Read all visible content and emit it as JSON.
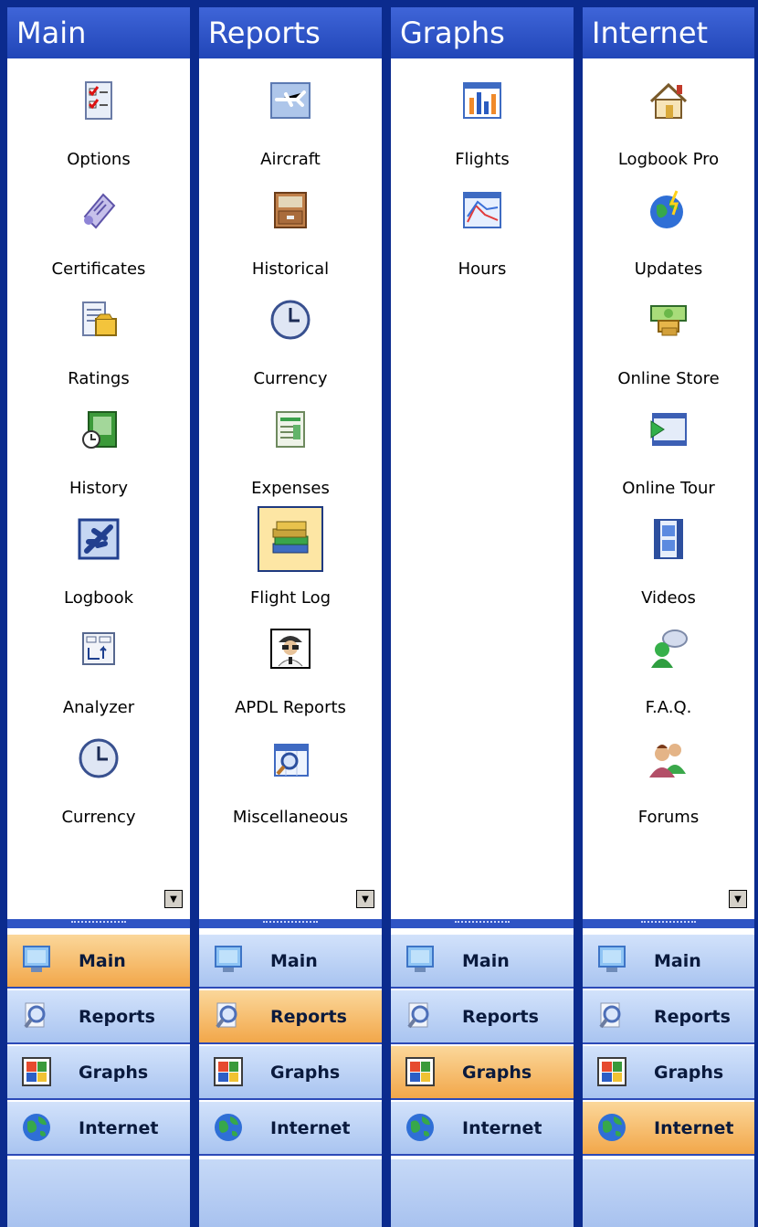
{
  "panels": [
    {
      "header": "Main",
      "items": [
        {
          "label": "Options",
          "icon": "checklist-icon"
        },
        {
          "label": "Certificates",
          "icon": "certificate-scroll-icon"
        },
        {
          "label": "Ratings",
          "icon": "ratings-document-icon"
        },
        {
          "label": "History",
          "icon": "history-book-icon"
        },
        {
          "label": "Logbook",
          "icon": "airplane-logbook-icon"
        },
        {
          "label": "Analyzer",
          "icon": "analyzer-icon"
        },
        {
          "label": "Currency",
          "icon": "clock-icon"
        }
      ],
      "active_nav": "Main"
    },
    {
      "header": "Reports",
      "items": [
        {
          "label": "Aircraft",
          "icon": "aircraft-icon"
        },
        {
          "label": "Historical",
          "icon": "file-cabinet-icon"
        },
        {
          "label": "Currency",
          "icon": "clock-icon"
        },
        {
          "label": "Expenses",
          "icon": "spreadsheet-icon"
        },
        {
          "label": "Flight Log",
          "icon": "books-icon",
          "selected": true
        },
        {
          "label": "APDL Reports",
          "icon": "pilot-icon"
        },
        {
          "label": "Miscellaneous",
          "icon": "calendar-search-icon"
        }
      ],
      "active_nav": "Reports"
    },
    {
      "header": "Graphs",
      "items": [
        {
          "label": "Flights",
          "icon": "bar-chart-icon"
        },
        {
          "label": "Hours",
          "icon": "line-chart-icon"
        }
      ],
      "active_nav": "Graphs"
    },
    {
      "header": "Internet",
      "items": [
        {
          "label": "Logbook Pro",
          "icon": "home-icon"
        },
        {
          "label": "Updates",
          "icon": "globe-lightning-icon"
        },
        {
          "label": "Online Store",
          "icon": "money-icon"
        },
        {
          "label": "Online Tour",
          "icon": "film-play-icon"
        },
        {
          "label": "Videos",
          "icon": "film-icon"
        },
        {
          "label": "F.A.Q.",
          "icon": "speech-person-icon"
        },
        {
          "label": "Forums",
          "icon": "people-icon"
        }
      ],
      "active_nav": "Internet"
    }
  ],
  "nav_buttons": [
    {
      "label": "Main",
      "icon": "monitor-icon"
    },
    {
      "label": "Reports",
      "icon": "magnifier-doc-icon"
    },
    {
      "label": "Graphs",
      "icon": "graphs-window-icon"
    },
    {
      "label": "Internet",
      "icon": "globe-icon"
    }
  ],
  "colors": {
    "frame": "#0b2b8e",
    "header": "#2c52c8",
    "nav_active": "#f4ae56",
    "nav_inactive": "#bcd2f6"
  }
}
